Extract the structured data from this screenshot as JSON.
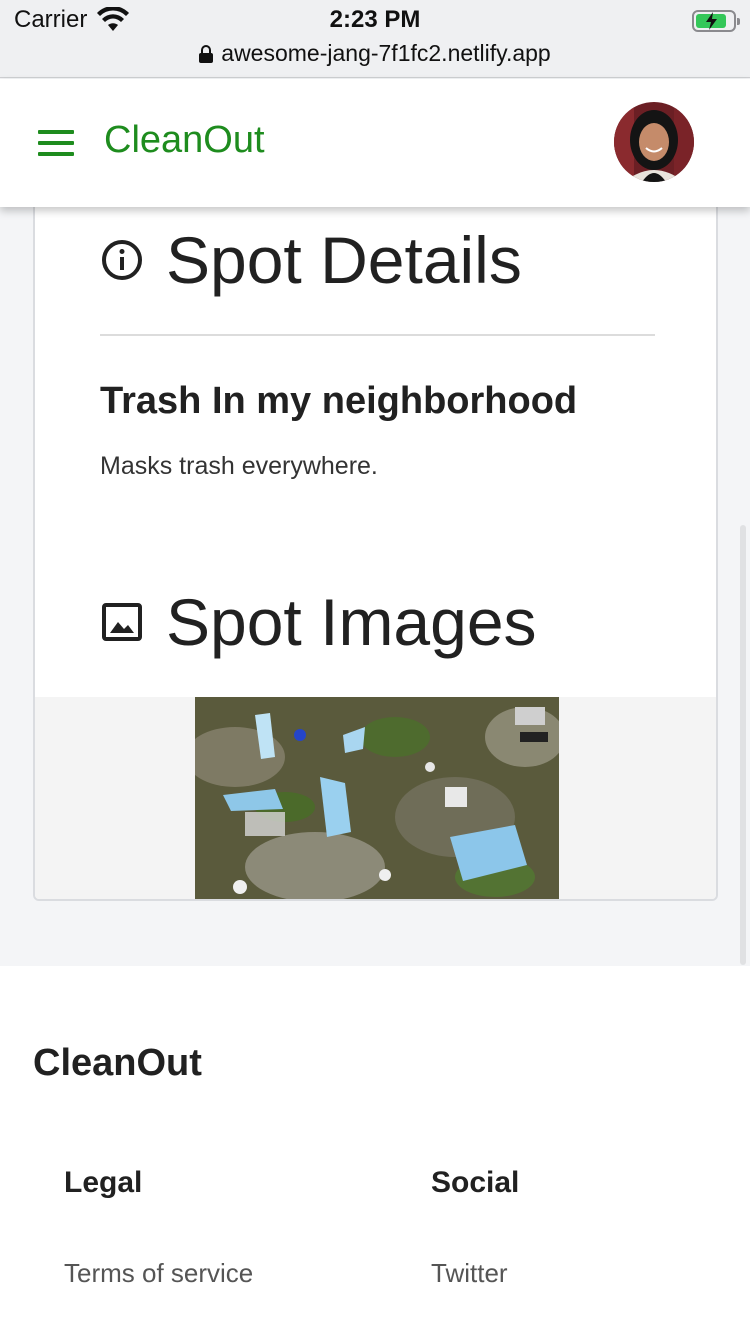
{
  "status_bar": {
    "carrier": "Carrier",
    "time": "2:23 PM",
    "url": "awesome-jang-7f1fc2.netlify.app"
  },
  "app_bar": {
    "brand": "CleanOut",
    "menu_icon": "hamburger-icon",
    "brand_color": "#1e8c1e"
  },
  "spot_details": {
    "heading": "Spot Details",
    "icon": "info-icon",
    "name": "Trash In my neighborhood",
    "description": "Masks trash everywhere."
  },
  "spot_images": {
    "heading": "Spot Images",
    "icon": "image-icon"
  },
  "footer": {
    "brand": "CleanOut",
    "legal": {
      "title": "Legal",
      "links": [
        "Terms of service"
      ]
    },
    "social": {
      "title": "Social",
      "links": [
        "Twitter"
      ]
    }
  }
}
